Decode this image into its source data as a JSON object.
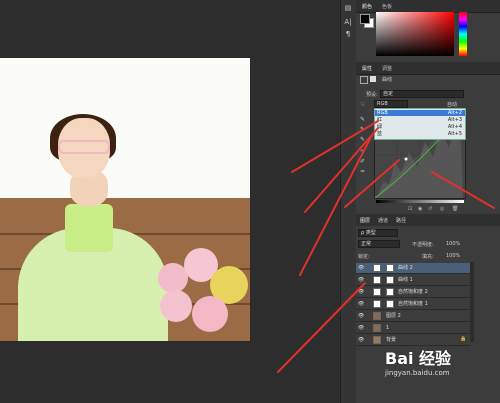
{
  "panel_tabs_top": {
    "color": "颜色",
    "swatches": "色板"
  },
  "panel_tabs_mid": {
    "properties": "属性",
    "adjust": "调整"
  },
  "properties": {
    "title": "曲线",
    "preset_label": "预设:",
    "preset_value": "自定",
    "channel_value": "RGB",
    "auto_button": "自动"
  },
  "channel_menu": [
    {
      "label": "RGB",
      "shortcut": "Alt+2",
      "selected": true
    },
    {
      "label": "红",
      "shortcut": "Alt+3",
      "selected": false
    },
    {
      "label": "绿",
      "shortcut": "Alt+4",
      "selected": false
    },
    {
      "label": "蓝",
      "shortcut": "Alt+5",
      "selected": false
    }
  ],
  "layers_tabs": {
    "layers": "图层",
    "channels": "通道",
    "paths": "路径"
  },
  "layers_toolbar": {
    "kind_filter": "ρ 类型",
    "blend_mode": "正常",
    "opacity_label": "不透明度:",
    "opacity_value": "100%",
    "lock_label": "锁定:",
    "fill_label": "填充:",
    "fill_value": "100%"
  },
  "layers": [
    {
      "name": "曲线 2",
      "selected": true
    },
    {
      "name": "曲线 1",
      "selected": false
    },
    {
      "name": "自然饱和度 2",
      "selected": false
    },
    {
      "name": "自然饱和度 1",
      "selected": false
    },
    {
      "name": "图层 2",
      "selected": false
    },
    {
      "name": "1",
      "selected": false
    },
    {
      "name": "背景",
      "selected": false
    }
  ],
  "side_labels": {
    "a": "A|",
    "p": "¶"
  },
  "watermark": {
    "brand": "Bai 经验",
    "url": "jingyan.baidu.com"
  },
  "colors": {
    "arrow": "#e0322a",
    "selection": "#3a7bd5",
    "panel": "#3c3c3c"
  }
}
